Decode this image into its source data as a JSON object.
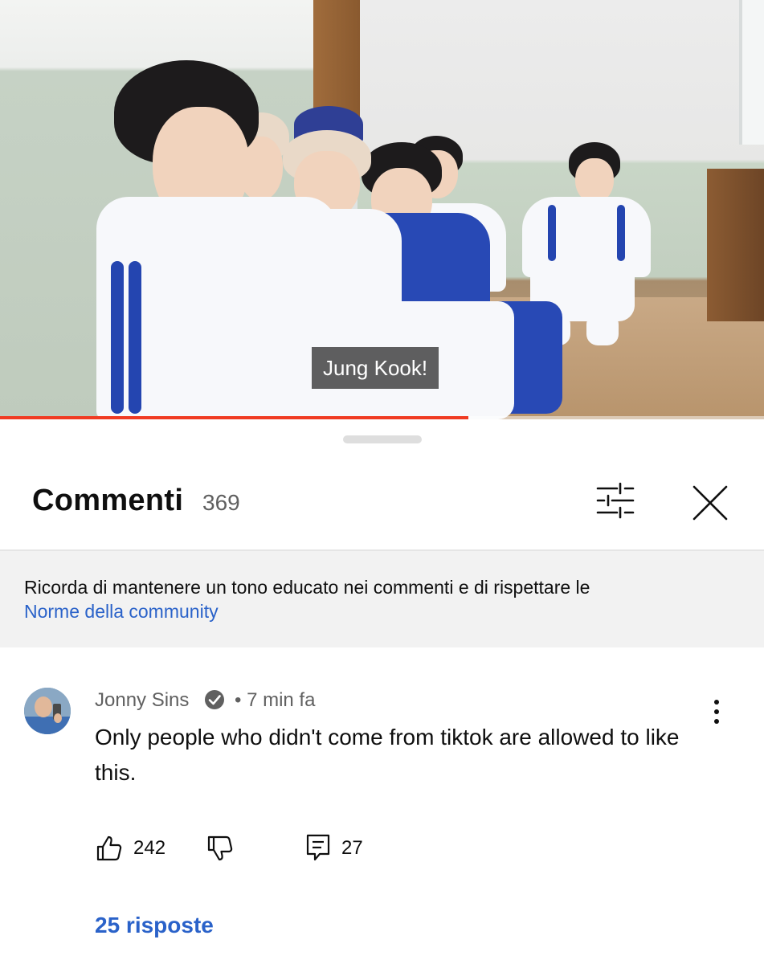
{
  "video": {
    "subtitle": "Jung Kook!",
    "progress": 0.613,
    "progress_color": "#f03b23"
  },
  "comments_panel": {
    "title": "Commenti",
    "count": "369",
    "filter_icon": "sliders-icon",
    "close_icon": "close-icon",
    "notice": {
      "text": "Ricorda di mantenere un tono educato nei commenti e di rispettare le",
      "link": "Norme della community"
    }
  },
  "comment": {
    "author": "Jonny Sins",
    "verified_icon": "verified-check-icon",
    "time": "• 7 min fa",
    "text": "Only people who didn't come from tiktok are allowed to like this.",
    "likes": "242",
    "reply_count": "27",
    "replies_label": "25 risposte"
  },
  "colors": {
    "link": "#2a62c9",
    "text": "#0f0f0f",
    "secondary": "#606060",
    "notice_bg": "#f2f2f2"
  }
}
